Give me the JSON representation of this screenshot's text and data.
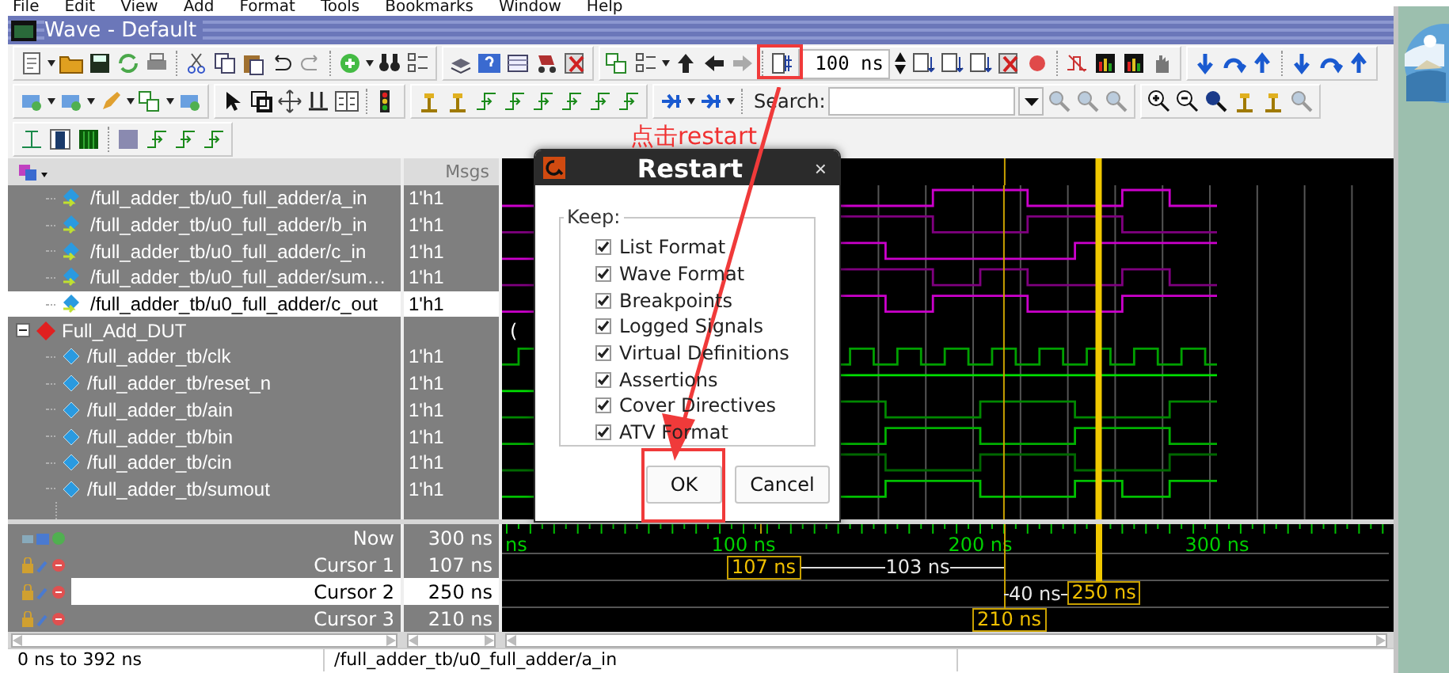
{
  "menu": [
    {
      "label": "File"
    },
    {
      "label": "Edit"
    },
    {
      "label": "View"
    },
    {
      "label": "Add"
    },
    {
      "label": "Format"
    },
    {
      "label": "Tools"
    },
    {
      "label": "Bookmarks"
    },
    {
      "label": "Window"
    },
    {
      "label": "Help"
    }
  ],
  "window": {
    "title": "Wave - Default"
  },
  "toolbar": {
    "time_step": "100 ns",
    "search_label": "Search:"
  },
  "annotation": {
    "text": "点击restart"
  },
  "wave_panel": {
    "msgs_header": "Msgs"
  },
  "signals": [
    {
      "name": "/full_adder_tb/u0_full_adder/a_in",
      "value": "1'h1",
      "kind": "port",
      "color": "#cc00cc",
      "selected": false
    },
    {
      "name": "/full_adder_tb/u0_full_adder/b_in",
      "value": "1'h1",
      "kind": "port",
      "color": "#800080",
      "selected": false
    },
    {
      "name": "/full_adder_tb/u0_full_adder/c_in",
      "value": "1'h1",
      "kind": "port",
      "color": "#cc00cc",
      "selected": false
    },
    {
      "name": "/full_adder_tb/u0_full_adder/sum…",
      "value": "1'h1",
      "kind": "port",
      "color": "#800080",
      "selected": false
    },
    {
      "name": "/full_adder_tb/u0_full_adder/c_out",
      "value": "1'h1",
      "kind": "port",
      "color": "#cc00cc",
      "selected": true
    },
    {
      "name": "Full_Add_DUT",
      "kind": "group",
      "expanded": true,
      "wave_text": "(",
      "children": [
        {
          "name": "/full_adder_tb/clk",
          "value": "1'h1",
          "kind": "signal",
          "color": "#00a000",
          "selected": false
        },
        {
          "name": "/full_adder_tb/reset_n",
          "value": "1'h1",
          "kind": "signal",
          "color": "#00e000",
          "selected": false
        },
        {
          "name": "/full_adder_tb/ain",
          "value": "1'h1",
          "kind": "signal",
          "color": "#008800",
          "selected": false
        },
        {
          "name": "/full_adder_tb/bin",
          "value": "1'h1",
          "kind": "signal",
          "color": "#00b000",
          "selected": false
        },
        {
          "name": "/full_adder_tb/cin",
          "value": "1'h1",
          "kind": "signal",
          "color": "#006800",
          "selected": false
        },
        {
          "name": "/full_adder_tb/sumout",
          "value": "1'h1",
          "kind": "signal",
          "color": "#00c000",
          "selected": false
        }
      ]
    }
  ],
  "cursors": [
    {
      "label": "Now",
      "value": "300 ns",
      "kind": "now",
      "selected": false
    },
    {
      "label": "Cursor 1",
      "value": "107 ns",
      "kind": "cursor",
      "selected": false
    },
    {
      "label": "Cursor 2",
      "value": "250 ns",
      "kind": "cursor",
      "selected": true
    },
    {
      "label": "Cursor 3",
      "value": "210 ns",
      "kind": "cursor",
      "selected": false
    }
  ],
  "timeline": {
    "ticks": [
      "ns",
      "100 ns",
      "200 ns",
      "300 ns"
    ],
    "flags": [
      {
        "text": "107 ns"
      },
      {
        "text": "250 ns"
      },
      {
        "text": "210 ns"
      }
    ],
    "deltas": [
      {
        "text": "103 ns"
      },
      {
        "text": "40 ns"
      }
    ]
  },
  "status_bar": {
    "range": "0 ns to 392 ns",
    "signal": "/full_adder_tb/u0_full_adder/a_in"
  },
  "dialog": {
    "title": "Restart",
    "close": "×",
    "group_label": "Keep:",
    "options": [
      {
        "label": "List Format",
        "checked": true
      },
      {
        "label": "Wave Format",
        "checked": true
      },
      {
        "label": "Breakpoints",
        "checked": true
      },
      {
        "label": "Logged Signals",
        "checked": true
      },
      {
        "label": "Virtual Definitions",
        "checked": true
      },
      {
        "label": "Assertions",
        "checked": true
      },
      {
        "label": "Cover Directives",
        "checked": true
      },
      {
        "label": "ATV Format",
        "checked": true
      }
    ],
    "buttons": [
      {
        "label": "OK"
      },
      {
        "label": "Cancel"
      }
    ]
  }
}
